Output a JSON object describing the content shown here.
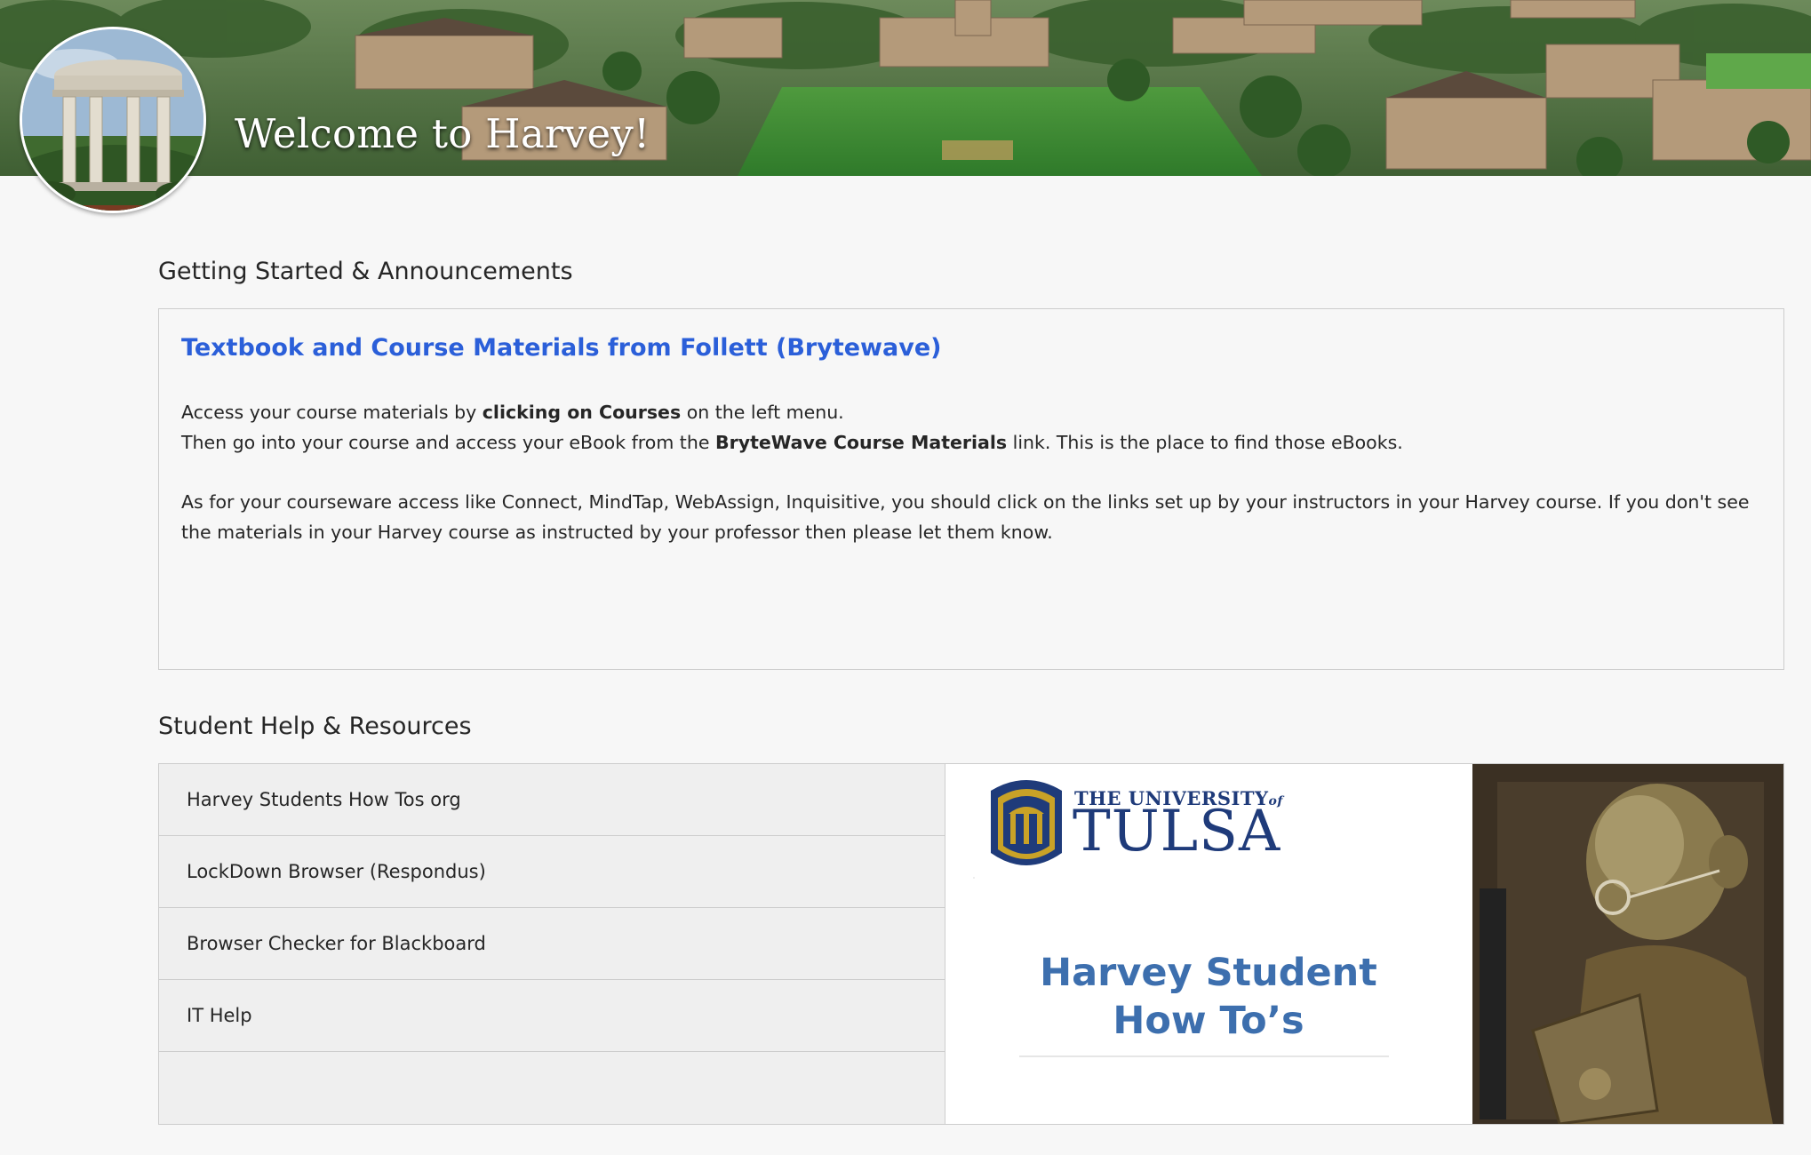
{
  "banner": {
    "title": "Welcome to Harvey!"
  },
  "sections": {
    "getting_started": {
      "heading": "Getting Started & Announcements",
      "announcement": {
        "title": "Textbook and Course Materials from Follett (Brytewave)",
        "line1_pre": "Access your course materials by ",
        "line1_bold": "clicking on Courses",
        "line1_post": " on the left menu.",
        "line2_pre": "Then go into your course and access your eBook from the ",
        "line2_bold": "BryteWave Course Materials",
        "line2_post": " link. This is the place to find those eBooks.",
        "paragraph2": "As for your courseware access like Connect, MindTap, WebAssign, Inquisitive, you should click on the links set up by your instructors in your Harvey course. If you don't see the materials in your Harvey course as instructed by your professor then please let them know."
      }
    },
    "student_help": {
      "heading": "Student Help & Resources",
      "items": [
        {
          "label": "Harvey Students How Tos org"
        },
        {
          "label": "LockDown Browser (Respondus)"
        },
        {
          "label": "Browser Checker for Blackboard"
        },
        {
          "label": "IT Help"
        }
      ],
      "image": {
        "logo_small": "THE UNIVERSITY",
        "logo_of": "of",
        "logo_main": "TULSA",
        "title_line1": "Harvey Student",
        "title_line2": "How To’s"
      }
    }
  },
  "colors": {
    "link_blue": "#2b5fd9",
    "tulsa_navy": "#1f3b7a",
    "tulsa_gold": "#c9a227",
    "howto_blue": "#3d6fae"
  }
}
